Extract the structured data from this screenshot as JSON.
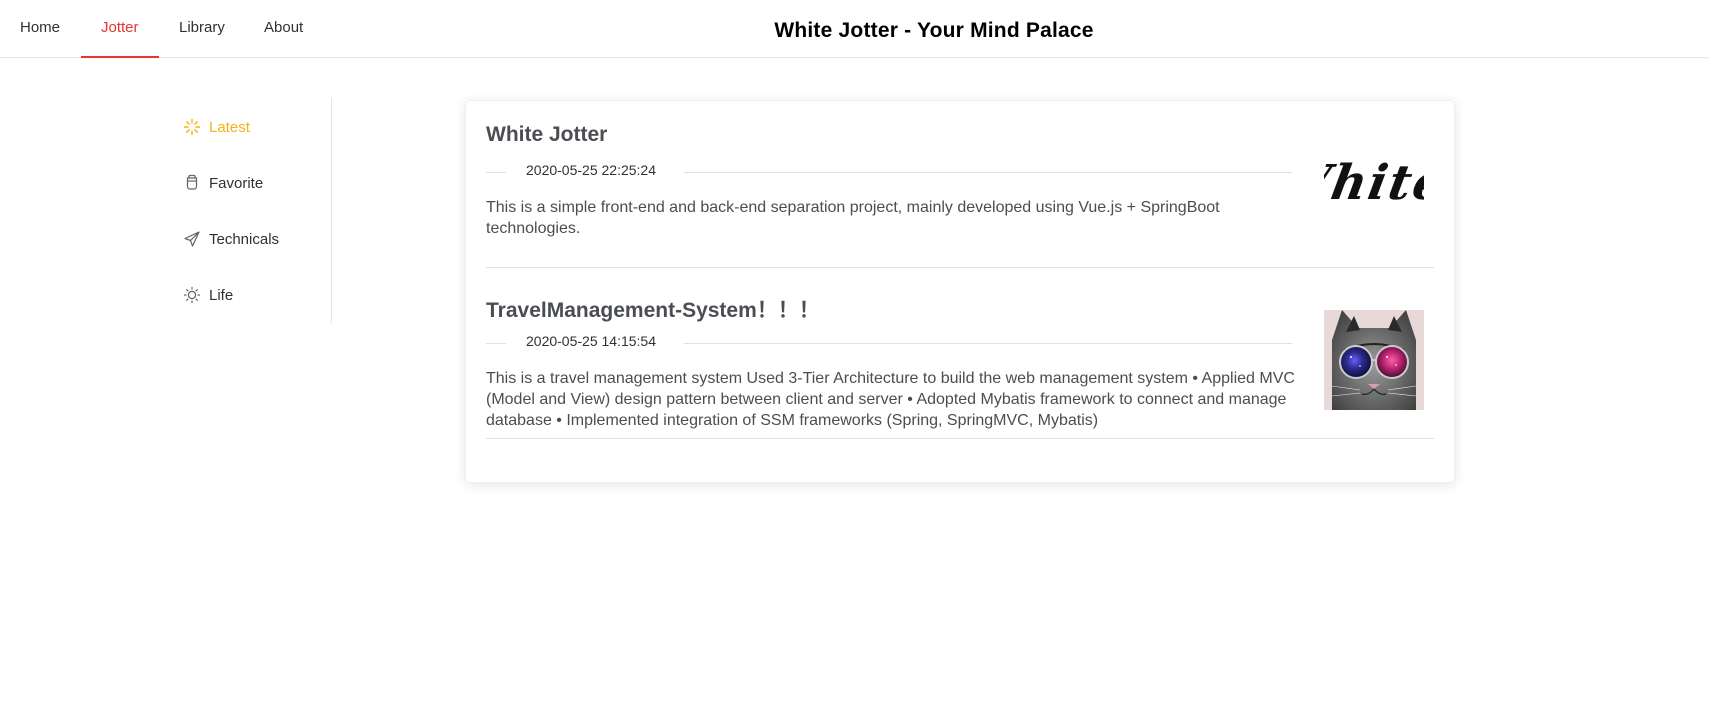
{
  "nav": {
    "items": [
      {
        "label": "Home",
        "active": false
      },
      {
        "label": "Jotter",
        "active": true
      },
      {
        "label": "Library",
        "active": false
      },
      {
        "label": "About",
        "active": false
      }
    ],
    "active_color": "#e8352f"
  },
  "site": {
    "title": "White Jotter - Your Mind Palace"
  },
  "side_menu": {
    "items": [
      {
        "label": "Latest",
        "icon": "loading-icon",
        "active": true
      },
      {
        "label": "Favorite",
        "icon": "cup-icon",
        "active": false
      },
      {
        "label": "Technicals",
        "icon": "send-icon",
        "active": false
      },
      {
        "label": "Life",
        "icon": "sun-icon",
        "active": false
      }
    ],
    "active_color": "#f7b21a"
  },
  "articles": [
    {
      "title": "White Jotter",
      "date": "2020-05-25 22:25:24",
      "abstract": "This is a simple front-end and back-end separation project, mainly developed using Vue.js + SpringBoot technologies.",
      "cover_text": "White Jotter"
    },
    {
      "title": "TravelManagement-System！！！",
      "date": "2020-05-25 14:15:54",
      "abstract": "This is a travel management system Used 3-Tier Architecture to build the web management system • Applied MVC (Model and View) design pattern between client and server • Adopted Mybatis framework to connect and manage database • Implemented integration of SSM frameworks (Spring, SpringMVC, Mybatis)",
      "cover_image": "cat-with-galaxy-sunglasses"
    }
  ]
}
